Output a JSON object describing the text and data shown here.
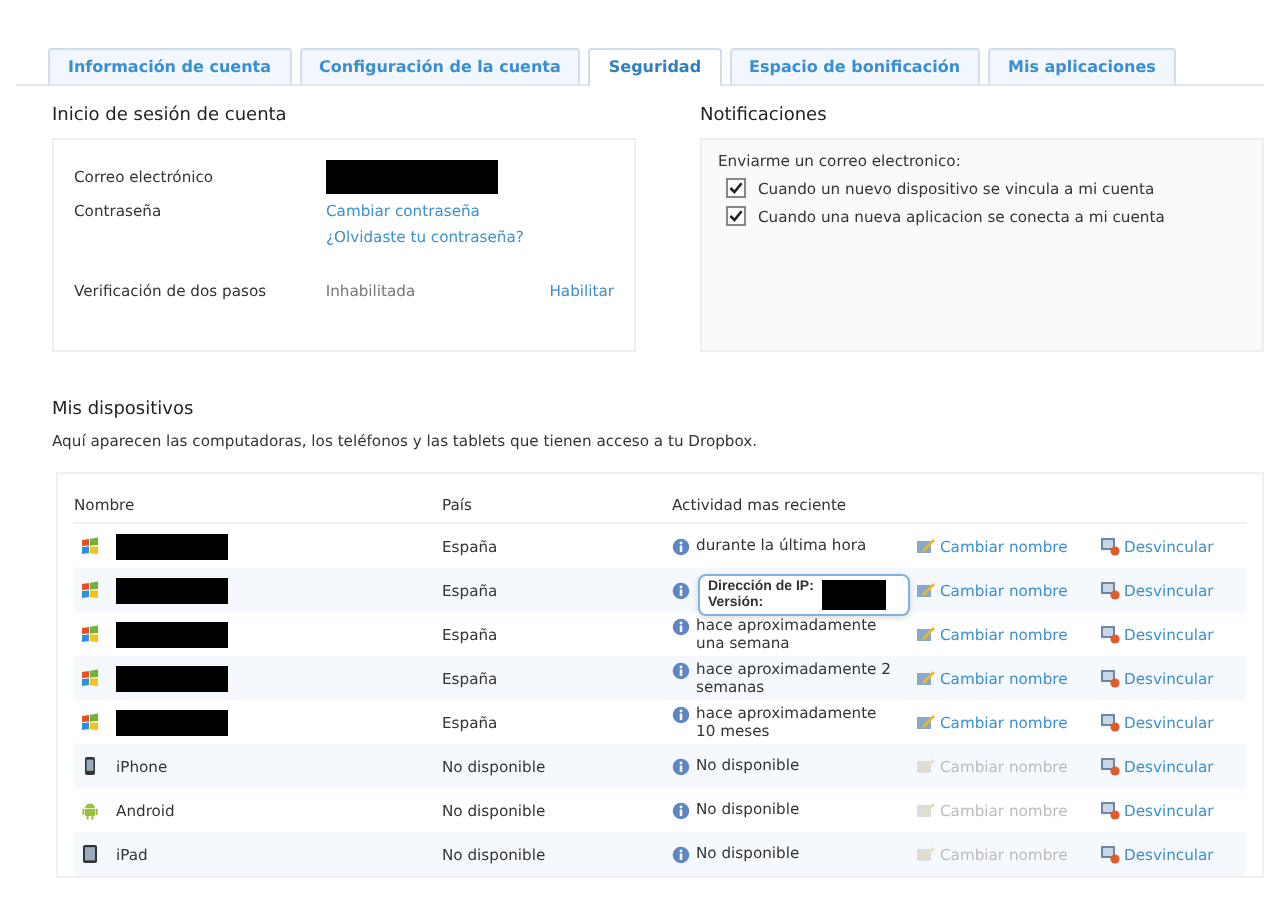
{
  "tabs": [
    {
      "label": "Información de cuenta",
      "selected": false
    },
    {
      "label": "Configuración de la cuenta",
      "selected": false
    },
    {
      "label": "Seguridad",
      "selected": true
    },
    {
      "label": "Espacio de bonificación",
      "selected": false
    },
    {
      "label": "Mis aplicaciones",
      "selected": false
    }
  ],
  "login": {
    "title": "Inicio de sesión de cuenta",
    "email_label": "Correo electrónico",
    "password_label": "Contraseña",
    "change_password": "Cambiar contraseña",
    "forgot_password": "¿Olvidaste tu contraseña?",
    "two_step_label": "Verificación de dos pasos",
    "two_step_status": "Inhabilitada",
    "enable": "Habilitar"
  },
  "notifications": {
    "title": "Notificaciones",
    "intro": "Enviarme un correo electronico:",
    "options": [
      {
        "label": "Cuando un nuevo dispositivo se vincula a mi cuenta",
        "checked": true
      },
      {
        "label": "Cuando una nueva aplicacion se conecta a mi cuenta",
        "checked": true
      }
    ]
  },
  "devices": {
    "title": "Mis dispositivos",
    "description": "Aquí aparecen las computadoras, los teléfonos y las tablets que tienen acceso a tu Dropbox.",
    "columns": [
      "Nombre",
      "País",
      "Actividad mas reciente"
    ],
    "rows": [
      {
        "kind": "windows",
        "redacted": true,
        "country": "España",
        "activity": "durante la última hora",
        "rename": "Cambiar nombre",
        "rename_disabled": false,
        "unlink": "Desvincular"
      },
      {
        "kind": "windows",
        "redacted": true,
        "country": "España",
        "rename": "Cambiar nombre",
        "rename_disabled": false,
        "unlink": "Desvincular"
      },
      {
        "kind": "windows",
        "redacted": true,
        "country": "España",
        "activity": "hace aproximadamente una semana",
        "rename": "Cambiar nombre",
        "rename_disabled": false,
        "unlink": "Desvincular"
      },
      {
        "kind": "windows",
        "redacted": true,
        "country": "España",
        "activity": "hace aproximadamente 2 semanas",
        "rename": "Cambiar nombre",
        "rename_disabled": false,
        "unlink": "Desvincular"
      },
      {
        "kind": "windows",
        "redacted": true,
        "country": "España",
        "activity": "hace aproximadamente 10 meses",
        "rename": "Cambiar nombre",
        "rename_disabled": false,
        "unlink": "Desvincular"
      },
      {
        "kind": "phone",
        "redacted": false,
        "name": "iPhone",
        "country": "No disponible",
        "activity": "No disponible",
        "rename": "Cambiar nombre",
        "rename_disabled": true,
        "unlink": "Desvincular"
      },
      {
        "kind": "android",
        "redacted": false,
        "name": "Android",
        "country": "No disponible",
        "activity": "No disponible",
        "rename": "Cambiar nombre",
        "rename_disabled": true,
        "unlink": "Desvincular"
      },
      {
        "kind": "tablet",
        "redacted": false,
        "name": "iPad",
        "country": "No disponible",
        "activity": "No disponible",
        "rename": "Cambiar nombre",
        "rename_disabled": true,
        "unlink": "Desvincular"
      }
    ],
    "tooltip": {
      "ip_label": "Dirección de IP:",
      "version_label": "Versión:"
    }
  }
}
